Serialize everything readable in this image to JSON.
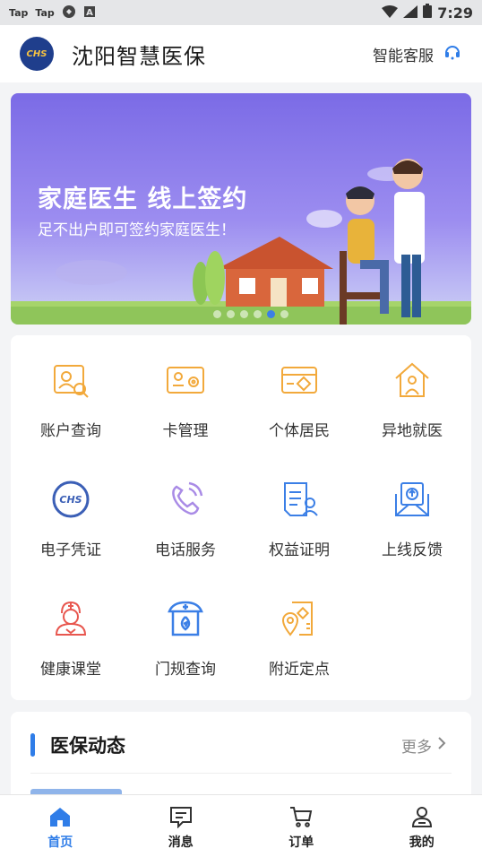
{
  "status_bar": {
    "left_items": [
      "Tap",
      "Tap"
    ],
    "time": "7:29"
  },
  "header": {
    "logo_text": "CHS",
    "title": "沈阳智慧医保",
    "service_label": "智能客服"
  },
  "banner": {
    "title": "家庭医生 线上签约",
    "subtitle": "足不出户即可签约家庭医生！",
    "page_count": 6,
    "active_page": 5
  },
  "grid": [
    {
      "label": "账户查询",
      "icon": "account-search-icon"
    },
    {
      "label": "卡管理",
      "icon": "card-manage-icon"
    },
    {
      "label": "个体居民",
      "icon": "resident-card-icon"
    },
    {
      "label": "异地就医",
      "icon": "remote-medical-icon"
    },
    {
      "label": "电子凭证",
      "icon": "chs-voucher-icon"
    },
    {
      "label": "电话服务",
      "icon": "phone-service-icon"
    },
    {
      "label": "权益证明",
      "icon": "rights-certificate-icon"
    },
    {
      "label": "上线反馈",
      "icon": "feedback-mail-icon"
    },
    {
      "label": "健康课堂",
      "icon": "health-class-icon"
    },
    {
      "label": "门规查询",
      "icon": "clinic-rules-icon"
    },
    {
      "label": "附近定点",
      "icon": "nearby-location-icon"
    }
  ],
  "news": {
    "title": "医保动态",
    "more": "更多"
  },
  "tabbar": [
    {
      "label": "首页",
      "icon": "home-icon",
      "active": true
    },
    {
      "label": "消息",
      "icon": "message-icon",
      "active": false
    },
    {
      "label": "订单",
      "icon": "cart-icon",
      "active": false
    },
    {
      "label": "我的",
      "icon": "profile-icon",
      "active": false
    }
  ],
  "colors": {
    "accent": "#2f7de8",
    "icon_orange": "#f2a93b",
    "icon_blue": "#3b7fe6",
    "icon_purple": "#a98be6",
    "icon_red": "#e8574f"
  }
}
